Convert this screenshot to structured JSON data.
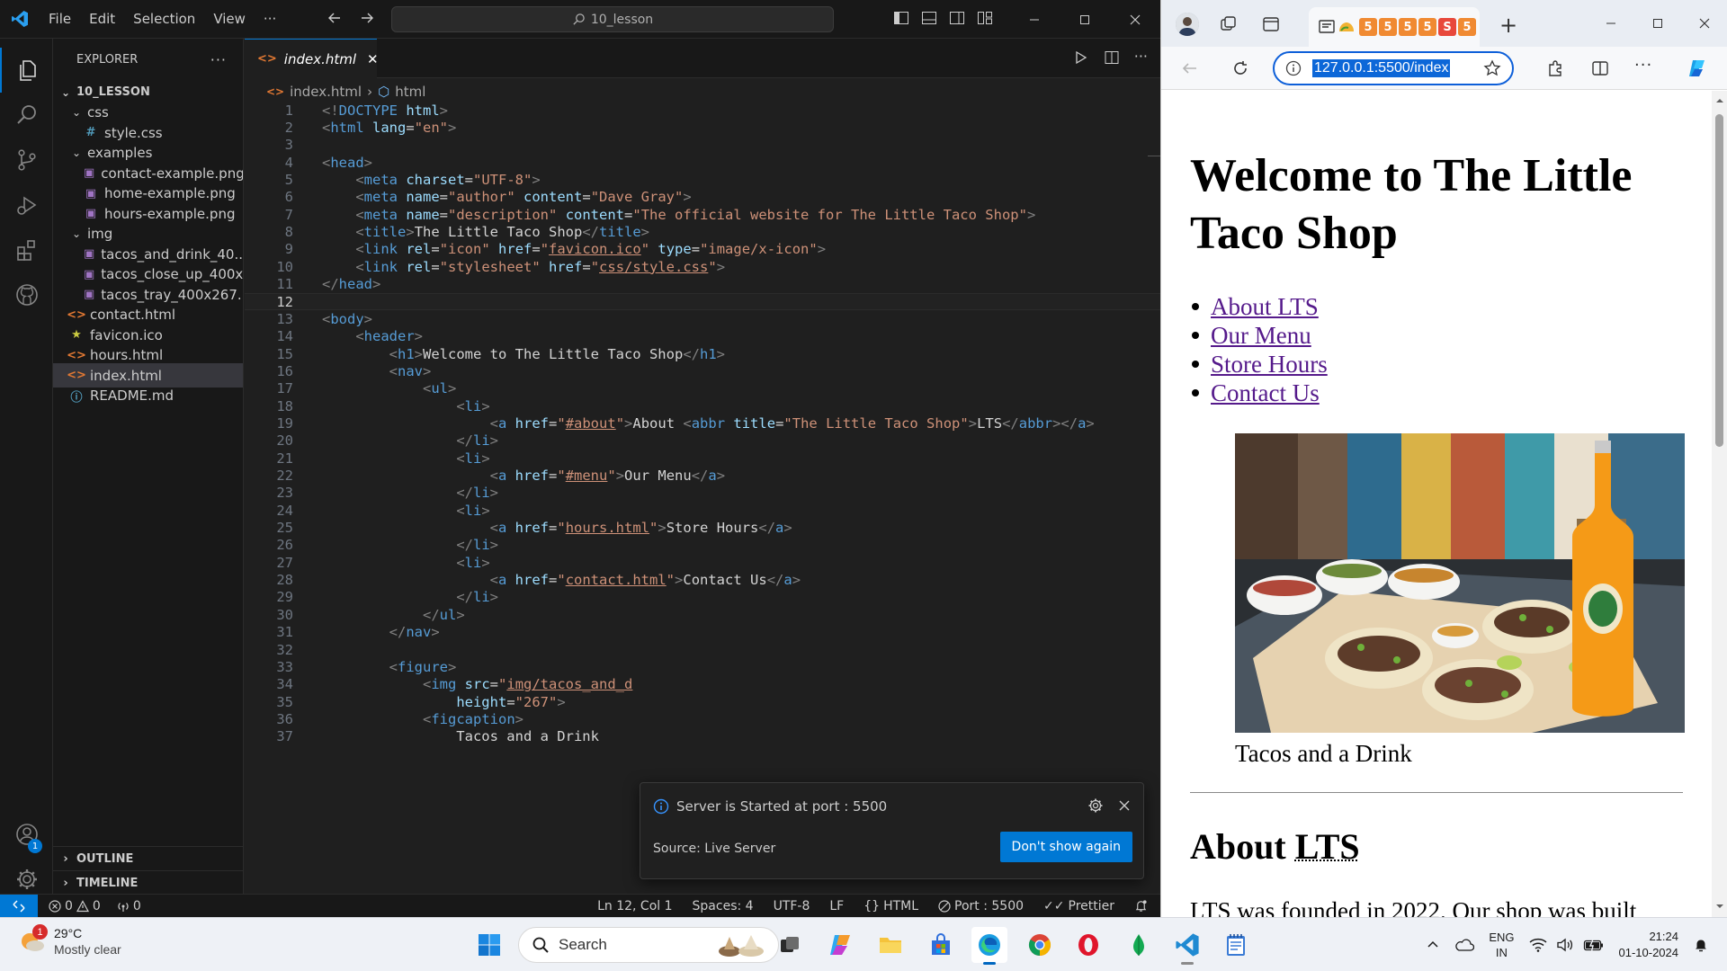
{
  "vscode": {
    "menu": [
      "File",
      "Edit",
      "Selection",
      "View",
      "···"
    ],
    "command_center": "10_lesson",
    "explorer_title": "EXPLORER",
    "root_folder": "10_LESSON",
    "tree": [
      {
        "label": "css",
        "type": "folder",
        "depth": 1
      },
      {
        "label": "style.css",
        "type": "css",
        "depth": 2
      },
      {
        "label": "examples",
        "type": "folder",
        "depth": 1
      },
      {
        "label": "contact-example.png",
        "type": "image",
        "depth": 2
      },
      {
        "label": "home-example.png",
        "type": "image",
        "depth": 2
      },
      {
        "label": "hours-example.png",
        "type": "image",
        "depth": 2
      },
      {
        "label": "img",
        "type": "folder",
        "depth": 1
      },
      {
        "label": "tacos_and_drink_40...",
        "type": "image",
        "depth": 2
      },
      {
        "label": "tacos_close_up_400x...",
        "type": "image",
        "depth": 2
      },
      {
        "label": "tacos_tray_400x267....",
        "type": "image",
        "depth": 2
      },
      {
        "label": "contact.html",
        "type": "html",
        "depth": 1
      },
      {
        "label": "favicon.ico",
        "type": "favicon",
        "depth": 1
      },
      {
        "label": "hours.html",
        "type": "html",
        "depth": 1
      },
      {
        "label": "index.html",
        "type": "html",
        "depth": 1,
        "selected": true
      },
      {
        "label": "README.md",
        "type": "info",
        "depth": 1
      }
    ],
    "outline_label": "OUTLINE",
    "timeline_label": "TIMELINE",
    "accounts_badge": "1",
    "active_tab": "index.html",
    "breadcrumb": [
      "index.html",
      "html"
    ],
    "current_line": 12,
    "code": [
      [
        [
          "br",
          "<!"
        ],
        [
          "tag",
          "DOCTYPE"
        ],
        [
          "txt",
          " "
        ],
        [
          "attr",
          "html"
        ],
        [
          "br",
          ">"
        ]
      ],
      [
        [
          "br",
          "<"
        ],
        [
          "tag",
          "html"
        ],
        [
          "txt",
          " "
        ],
        [
          "attr",
          "lang"
        ],
        [
          "txt",
          "="
        ],
        [
          "str",
          "\"en\""
        ],
        [
          "br",
          ">"
        ]
      ],
      [],
      [
        [
          "br",
          "<"
        ],
        [
          "tag",
          "head"
        ],
        [
          "br",
          ">"
        ]
      ],
      [
        [
          "txt",
          "    "
        ],
        [
          "br",
          "<"
        ],
        [
          "tag",
          "meta"
        ],
        [
          "txt",
          " "
        ],
        [
          "attr",
          "charset"
        ],
        [
          "txt",
          "="
        ],
        [
          "str",
          "\"UTF-8\""
        ],
        [
          "br",
          ">"
        ]
      ],
      [
        [
          "txt",
          "    "
        ],
        [
          "br",
          "<"
        ],
        [
          "tag",
          "meta"
        ],
        [
          "txt",
          " "
        ],
        [
          "attr",
          "name"
        ],
        [
          "txt",
          "="
        ],
        [
          "str",
          "\"author\""
        ],
        [
          "txt",
          " "
        ],
        [
          "attr",
          "content"
        ],
        [
          "txt",
          "="
        ],
        [
          "str",
          "\"Dave Gray\""
        ],
        [
          "br",
          ">"
        ]
      ],
      [
        [
          "txt",
          "    "
        ],
        [
          "br",
          "<"
        ],
        [
          "tag",
          "meta"
        ],
        [
          "txt",
          " "
        ],
        [
          "attr",
          "name"
        ],
        [
          "txt",
          "="
        ],
        [
          "str",
          "\"description\""
        ],
        [
          "txt",
          " "
        ],
        [
          "attr",
          "content"
        ],
        [
          "txt",
          "="
        ],
        [
          "str",
          "\"The official website for The Little Taco Shop\""
        ],
        [
          "br",
          ">"
        ]
      ],
      [
        [
          "txt",
          "    "
        ],
        [
          "br",
          "<"
        ],
        [
          "tag",
          "title"
        ],
        [
          "br",
          ">"
        ],
        [
          "txt",
          "The Little Taco Shop"
        ],
        [
          "br",
          "</"
        ],
        [
          "tag",
          "title"
        ],
        [
          "br",
          ">"
        ]
      ],
      [
        [
          "txt",
          "    "
        ],
        [
          "br",
          "<"
        ],
        [
          "tag",
          "link"
        ],
        [
          "txt",
          " "
        ],
        [
          "attr",
          "rel"
        ],
        [
          "txt",
          "="
        ],
        [
          "str",
          "\"icon\""
        ],
        [
          "txt",
          " "
        ],
        [
          "attr",
          "href"
        ],
        [
          "txt",
          "="
        ],
        [
          "str",
          "\""
        ],
        [
          "stru",
          "favicon.ico"
        ],
        [
          "str",
          "\""
        ],
        [
          "txt",
          " "
        ],
        [
          "attr",
          "type"
        ],
        [
          "txt",
          "="
        ],
        [
          "str",
          "\"image/x-icon\""
        ],
        [
          "br",
          ">"
        ]
      ],
      [
        [
          "txt",
          "    "
        ],
        [
          "br",
          "<"
        ],
        [
          "tag",
          "link"
        ],
        [
          "txt",
          " "
        ],
        [
          "attr",
          "rel"
        ],
        [
          "txt",
          "="
        ],
        [
          "str",
          "\"stylesheet\""
        ],
        [
          "txt",
          " "
        ],
        [
          "attr",
          "href"
        ],
        [
          "txt",
          "="
        ],
        [
          "str",
          "\""
        ],
        [
          "stru",
          "css/style.css"
        ],
        [
          "str",
          "\""
        ],
        [
          "br",
          ">"
        ]
      ],
      [
        [
          "br",
          "</"
        ],
        [
          "tag",
          "head"
        ],
        [
          "br",
          ">"
        ]
      ],
      [],
      [
        [
          "br",
          "<"
        ],
        [
          "tag",
          "body"
        ],
        [
          "br",
          ">"
        ]
      ],
      [
        [
          "txt",
          "    "
        ],
        [
          "br",
          "<"
        ],
        [
          "tag",
          "header"
        ],
        [
          "br",
          ">"
        ]
      ],
      [
        [
          "txt",
          "        "
        ],
        [
          "br",
          "<"
        ],
        [
          "tag",
          "h1"
        ],
        [
          "br",
          ">"
        ],
        [
          "txt",
          "Welcome to The Little Taco Shop"
        ],
        [
          "br",
          "</"
        ],
        [
          "tag",
          "h1"
        ],
        [
          "br",
          ">"
        ]
      ],
      [
        [
          "txt",
          "        "
        ],
        [
          "br",
          "<"
        ],
        [
          "tag",
          "nav"
        ],
        [
          "br",
          ">"
        ]
      ],
      [
        [
          "txt",
          "            "
        ],
        [
          "br",
          "<"
        ],
        [
          "tag",
          "ul"
        ],
        [
          "br",
          ">"
        ]
      ],
      [
        [
          "txt",
          "                "
        ],
        [
          "br",
          "<"
        ],
        [
          "tag",
          "li"
        ],
        [
          "br",
          ">"
        ]
      ],
      [
        [
          "txt",
          "                    "
        ],
        [
          "br",
          "<"
        ],
        [
          "tag",
          "a"
        ],
        [
          "txt",
          " "
        ],
        [
          "attr",
          "href"
        ],
        [
          "txt",
          "="
        ],
        [
          "str",
          "\""
        ],
        [
          "stru",
          "#about"
        ],
        [
          "str",
          "\""
        ],
        [
          "br",
          ">"
        ],
        [
          "txt",
          "About "
        ],
        [
          "br",
          "<"
        ],
        [
          "tag",
          "abbr"
        ],
        [
          "txt",
          " "
        ],
        [
          "attr",
          "title"
        ],
        [
          "txt",
          "="
        ],
        [
          "str",
          "\"The Little Taco Shop\""
        ],
        [
          "br",
          ">"
        ],
        [
          "txt",
          "LTS"
        ],
        [
          "br",
          "</"
        ],
        [
          "tag",
          "abbr"
        ],
        [
          "br",
          "></"
        ],
        [
          "tag",
          "a"
        ],
        [
          "br",
          ">"
        ]
      ],
      [
        [
          "txt",
          "                "
        ],
        [
          "br",
          "</"
        ],
        [
          "tag",
          "li"
        ],
        [
          "br",
          ">"
        ]
      ],
      [
        [
          "txt",
          "                "
        ],
        [
          "br",
          "<"
        ],
        [
          "tag",
          "li"
        ],
        [
          "br",
          ">"
        ]
      ],
      [
        [
          "txt",
          "                    "
        ],
        [
          "br",
          "<"
        ],
        [
          "tag",
          "a"
        ],
        [
          "txt",
          " "
        ],
        [
          "attr",
          "href"
        ],
        [
          "txt",
          "="
        ],
        [
          "str",
          "\""
        ],
        [
          "stru",
          "#menu"
        ],
        [
          "str",
          "\""
        ],
        [
          "br",
          ">"
        ],
        [
          "txt",
          "Our Menu"
        ],
        [
          "br",
          "</"
        ],
        [
          "tag",
          "a"
        ],
        [
          "br",
          ">"
        ]
      ],
      [
        [
          "txt",
          "                "
        ],
        [
          "br",
          "</"
        ],
        [
          "tag",
          "li"
        ],
        [
          "br",
          ">"
        ]
      ],
      [
        [
          "txt",
          "                "
        ],
        [
          "br",
          "<"
        ],
        [
          "tag",
          "li"
        ],
        [
          "br",
          ">"
        ]
      ],
      [
        [
          "txt",
          "                    "
        ],
        [
          "br",
          "<"
        ],
        [
          "tag",
          "a"
        ],
        [
          "txt",
          " "
        ],
        [
          "attr",
          "href"
        ],
        [
          "txt",
          "="
        ],
        [
          "str",
          "\""
        ],
        [
          "stru",
          "hours.html"
        ],
        [
          "str",
          "\""
        ],
        [
          "br",
          ">"
        ],
        [
          "txt",
          "Store Hours"
        ],
        [
          "br",
          "</"
        ],
        [
          "tag",
          "a"
        ],
        [
          "br",
          ">"
        ]
      ],
      [
        [
          "txt",
          "                "
        ],
        [
          "br",
          "</"
        ],
        [
          "tag",
          "li"
        ],
        [
          "br",
          ">"
        ]
      ],
      [
        [
          "txt",
          "                "
        ],
        [
          "br",
          "<"
        ],
        [
          "tag",
          "li"
        ],
        [
          "br",
          ">"
        ]
      ],
      [
        [
          "txt",
          "                    "
        ],
        [
          "br",
          "<"
        ],
        [
          "tag",
          "a"
        ],
        [
          "txt",
          " "
        ],
        [
          "attr",
          "href"
        ],
        [
          "txt",
          "="
        ],
        [
          "str",
          "\""
        ],
        [
          "stru",
          "contact.html"
        ],
        [
          "str",
          "\""
        ],
        [
          "br",
          ">"
        ],
        [
          "txt",
          "Contact Us"
        ],
        [
          "br",
          "</"
        ],
        [
          "tag",
          "a"
        ],
        [
          "br",
          ">"
        ]
      ],
      [
        [
          "txt",
          "                "
        ],
        [
          "br",
          "</"
        ],
        [
          "tag",
          "li"
        ],
        [
          "br",
          ">"
        ]
      ],
      [
        [
          "txt",
          "            "
        ],
        [
          "br",
          "</"
        ],
        [
          "tag",
          "ul"
        ],
        [
          "br",
          ">"
        ]
      ],
      [
        [
          "txt",
          "        "
        ],
        [
          "br",
          "</"
        ],
        [
          "tag",
          "nav"
        ],
        [
          "br",
          ">"
        ]
      ],
      [],
      [
        [
          "txt",
          "        "
        ],
        [
          "br",
          "<"
        ],
        [
          "tag",
          "figure"
        ],
        [
          "br",
          ">"
        ]
      ],
      [
        [
          "txt",
          "            "
        ],
        [
          "br",
          "<"
        ],
        [
          "tag",
          "img"
        ],
        [
          "txt",
          " "
        ],
        [
          "attr",
          "src"
        ],
        [
          "txt",
          "="
        ],
        [
          "str",
          "\""
        ],
        [
          "stru",
          "img/tacos_and_d"
        ]
      ],
      [
        [
          "txt",
          "                "
        ],
        [
          "attr",
          "height"
        ],
        [
          "txt",
          "="
        ],
        [
          "str",
          "\"267\""
        ],
        [
          "br",
          ">"
        ]
      ],
      [
        [
          "txt",
          "            "
        ],
        [
          "br",
          "<"
        ],
        [
          "tag",
          "figcaption"
        ],
        [
          "br",
          ">"
        ]
      ],
      [
        [
          "txt",
          "                Tacos and a Drink"
        ]
      ]
    ],
    "toast": {
      "message": "Server is Started at port : 5500",
      "source": "Source: Live Server",
      "button": "Don't show again"
    },
    "status": {
      "errors": "0",
      "warnings": "0",
      "ports": "0",
      "position": "Ln 12, Col 1",
      "spaces": "Spaces: 4",
      "encoding": "UTF-8",
      "eol": "LF",
      "language": "HTML",
      "port": "Port : 5500",
      "formatter": "Prettier"
    }
  },
  "browser": {
    "url": "127.0.0.1:5500/index",
    "tab_letters": [
      "5",
      "5",
      "5",
      "5",
      "S",
      "5",
      "5"
    ],
    "page": {
      "h1": "Welcome to The Little Taco Shop",
      "nav": [
        "About LTS",
        "Our Menu",
        "Store Hours",
        "Contact Us"
      ],
      "figcaption": "Tacos and a Drink",
      "h2_prefix": "About ",
      "h2_abbr": "LTS",
      "paragraph": "LTS was founded in 2022. Our shop was built"
    }
  },
  "taskbar": {
    "weather_temp": "29°C",
    "weather_desc": "Mostly clear",
    "weather_badge": "1",
    "search_placeholder": "Search",
    "lang_top": "ENG",
    "lang_bottom": "IN",
    "time": "21:24",
    "date": "01-10-2024"
  },
  "colors": {
    "vscode_accent": "#0078d4",
    "browser_link": "#551a8b",
    "edge_address_border": "#0d5fd9"
  }
}
